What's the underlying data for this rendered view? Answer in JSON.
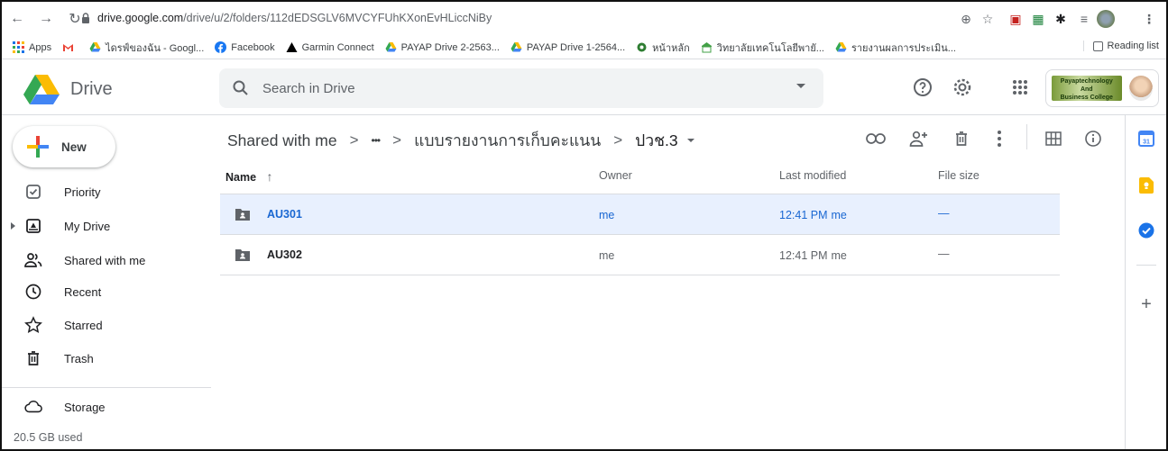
{
  "browser": {
    "url_host": "drive.google.com",
    "url_path": "/drive/u/2/folders/112dEDSGLV6MVCYFUhKXonEvHLiccNiBy",
    "bookmarks": [
      {
        "label": "Apps",
        "icon": "apps-grid-icon"
      },
      {
        "label": "",
        "icon": "gmail-icon"
      },
      {
        "label": "ไดรฟ์ของฉัน - Googl...",
        "icon": "google-drive-icon"
      },
      {
        "label": "Facebook",
        "icon": "facebook-icon"
      },
      {
        "label": "Garmin Connect",
        "icon": "garmin-icon"
      },
      {
        "label": "PAYAP Drive 2-2563...",
        "icon": "google-drive-icon"
      },
      {
        "label": "PAYAP Drive 1-2564...",
        "icon": "google-drive-icon"
      },
      {
        "label": "หน้าหลัก",
        "icon": "site-icon"
      },
      {
        "label": "วิทยาลัยเทคโนโลยีพายั...",
        "icon": "college-icon"
      },
      {
        "label": "รายงานผลการประเมิน...",
        "icon": "google-drive-icon"
      }
    ],
    "reading_list": "Reading list"
  },
  "header": {
    "app_name": "Drive",
    "search_placeholder": "Search in Drive",
    "org_banner_line1": "Payaptechnology",
    "org_banner_line2": "And",
    "org_banner_line3": "Business College"
  },
  "sidebar": {
    "new_label": "New",
    "items": [
      {
        "label": "Priority",
        "icon": "priority-check-icon"
      },
      {
        "label": "My Drive",
        "icon": "my-drive-icon"
      },
      {
        "label": "Shared with me",
        "icon": "shared-people-icon"
      },
      {
        "label": "Recent",
        "icon": "clock-icon"
      },
      {
        "label": "Starred",
        "icon": "star-icon"
      },
      {
        "label": "Trash",
        "icon": "trash-icon"
      },
      {
        "label": "Storage",
        "icon": "cloud-icon"
      }
    ],
    "storage_used": "20.5 GB used"
  },
  "breadcrumb": {
    "root": "Shared with me",
    "ellipsis": "•••",
    "parent": "แบบรายงานการเก็บคะแนน",
    "current": "ปวช.3",
    "separator": ">"
  },
  "table": {
    "headers": {
      "name": "Name",
      "owner": "Owner",
      "modified": "Last modified",
      "size": "File size"
    },
    "sort_arrow": "↑",
    "rows": [
      {
        "name": "AU301",
        "owner": "me",
        "modified_time": "12:41 PM",
        "modified_by": "me",
        "size": "—",
        "selected": true
      },
      {
        "name": "AU302",
        "owner": "me",
        "modified_time": "12:41 PM",
        "modified_by": "me",
        "size": "—",
        "selected": false
      }
    ]
  },
  "colors": {
    "selected_row_bg": "#e8f0fe",
    "selected_text": "#1967d2",
    "search_bg": "#f1f3f4",
    "divider": "#dadce0"
  }
}
